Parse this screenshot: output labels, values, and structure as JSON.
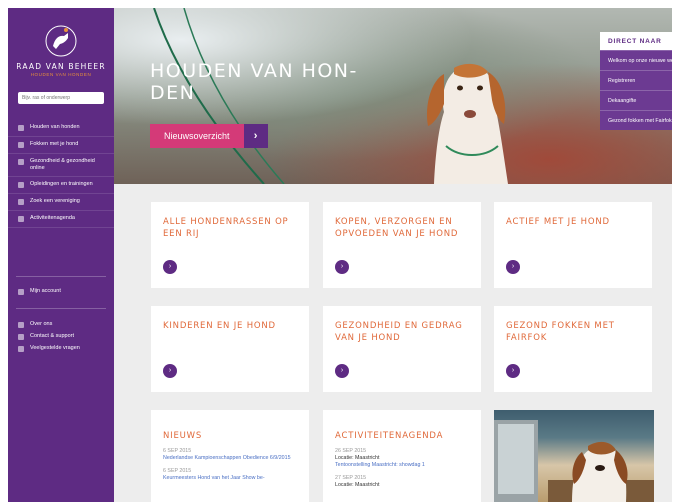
{
  "sidebar": {
    "logo_title": "RAAD VAN BEHEER",
    "logo_sub": "HOUDEN VAN HONDEN",
    "search_placeholder": "Bijv. ras of onderwerp",
    "nav": [
      {
        "label": "Houden van honden"
      },
      {
        "label": "Fokken met je hond"
      },
      {
        "label": "Gezondheid & gezondheid online"
      },
      {
        "label": "Opleidingen en trainingen"
      },
      {
        "label": "Zoek een vereniging"
      },
      {
        "label": "Activiteitenagenda"
      }
    ],
    "account": "Mijn account",
    "footer": [
      {
        "label": "Over ons"
      },
      {
        "label": "Contact & support"
      },
      {
        "label": "Veelgestelde vragen"
      }
    ]
  },
  "hero": {
    "title": "HOUDEN VAN HON-DEN",
    "button_label": "Nieuwsoverzicht",
    "button_arrow": "›"
  },
  "direct": {
    "heading": "DIRECT NAAR",
    "items": [
      {
        "label": "Welkom op onze nieuwe website!"
      },
      {
        "label": "Registreren"
      },
      {
        "label": "Dekaangifte"
      },
      {
        "label": "Gezond fokken met Fairfok"
      }
    ]
  },
  "cards": [
    {
      "title": "ALLE HONDENRASSEN OP EEN RIJ"
    },
    {
      "title": "KOPEN, VERZORGEN EN OPVOEDEN VAN JE HOND"
    },
    {
      "title": "ACTIEF MET JE HOND"
    },
    {
      "title": "KINDEREN EN JE HOND"
    },
    {
      "title": "GEZONDHEID EN GEDRAG VAN JE HOND"
    },
    {
      "title": "GEZOND FOKKEN MET FAIRFOK"
    }
  ],
  "go_glyph": "›",
  "news": {
    "title": "NIEUWS",
    "items": [
      {
        "date": "6 SEP 2015",
        "text": "Nederlandse Kampioenschappen Obedience 6/9/2015"
      },
      {
        "date": "6 SEP 2015",
        "text": "Keurmeesters Hond van het Jaar Show be-"
      }
    ]
  },
  "agenda": {
    "title": "ACTIVITEITENAGENDA",
    "items": [
      {
        "date": "26 SEP 2015",
        "location": "Locatie: Maastricht",
        "text": "Tentoonstelling Maastricht: showdag 1"
      },
      {
        "date": "27 SEP 2015",
        "location": "Locatie: Maastricht",
        "text": ""
      }
    ]
  },
  "colors": {
    "brand_purple": "#5e2b83",
    "accent_pink": "#d43a78",
    "accent_orange": "#e0693a",
    "link_blue": "#4a6fc4"
  }
}
